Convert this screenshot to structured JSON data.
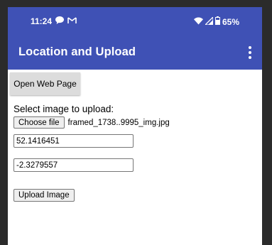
{
  "status_bar": {
    "time": "11:24",
    "battery": "65%"
  },
  "app_bar": {
    "title": "Location and Upload"
  },
  "content": {
    "open_web_page_label": "Open Web Page",
    "select_label": "Select image to upload:",
    "choose_file_label": "Choose file",
    "file_name": "framed_1738..9995_img.jpg",
    "latitude_value": "52.1416451",
    "longitude_value": "-2.3279557",
    "upload_label": "Upload Image"
  },
  "colors": {
    "primary": "#3f51b5"
  }
}
